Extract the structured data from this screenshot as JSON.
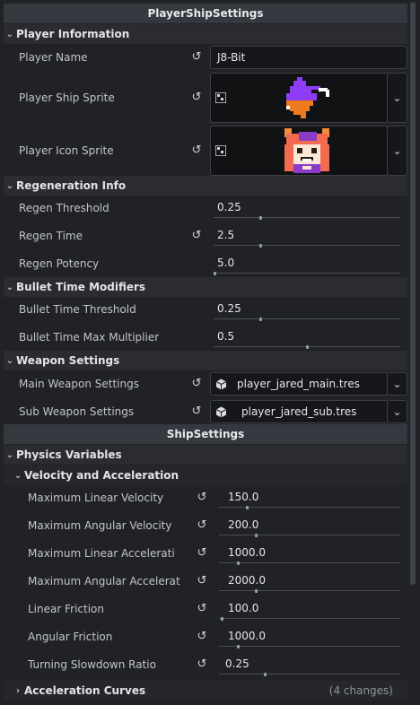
{
  "player_ship_settings": {
    "title": "PlayerShipSettings",
    "player_information": {
      "label": "Player Information",
      "player_name": {
        "label": "Player Name",
        "value": "J8-Bit"
      },
      "player_ship_sprite": {
        "label": "Player Ship Sprite"
      },
      "player_icon_sprite": {
        "label": "Player Icon Sprite"
      }
    },
    "regeneration_info": {
      "label": "Regeneration Info",
      "regen_threshold": {
        "label": "Regen Threshold",
        "value": "0.25",
        "slider": 0.25
      },
      "regen_time": {
        "label": "Regen Time",
        "value": "2.5",
        "slider": 0.25
      },
      "regen_potency": {
        "label": "Regen Potency",
        "value": "5.0",
        "slider": 0.0
      }
    },
    "bullet_time_modifiers": {
      "label": "Bullet Time Modifiers",
      "bullet_time_threshold": {
        "label": "Bullet Time Threshold",
        "value": "0.25",
        "slider": 0.25
      },
      "bullet_time_max_multiplier": {
        "label": "Bullet Time Max Multiplier",
        "value": "0.5",
        "slider": 0.5
      }
    },
    "weapon_settings": {
      "label": "Weapon Settings",
      "main_weapon_settings": {
        "label": "Main Weapon Settings",
        "value": "player_jared_main.tres"
      },
      "sub_weapon_settings": {
        "label": "Sub Weapon Settings",
        "value": "player_jared_sub.tres"
      }
    }
  },
  "ship_settings": {
    "title": "ShipSettings",
    "physics_variables": {
      "label": "Physics Variables",
      "velocity_and_acceleration": {
        "label": "Velocity and Acceleration",
        "maximum_linear_velocity": {
          "label": "Maximum Linear Velocity",
          "value": "150.0",
          "slider": 0.15
        },
        "maximum_angular_velocity": {
          "label": "Maximum Angular Velocity",
          "value": "200.0",
          "slider": 0.2
        },
        "maximum_linear_acceleration": {
          "label": "Maximum Linear Accelerati",
          "value": "1000.0",
          "slider": 0.1
        },
        "maximum_angular_acceleration": {
          "label": "Maximum Angular Accelerat",
          "value": "2000.0",
          "slider": 0.2
        },
        "linear_friction": {
          "label": "Linear Friction",
          "value": "100.0",
          "slider": 0.01
        },
        "angular_friction": {
          "label": "Angular Friction",
          "value": "1000.0",
          "slider": 0.1
        },
        "turning_slowdown_ratio": {
          "label": "Turning Slowdown Ratio",
          "value": "0.25",
          "slider": 0.25
        }
      },
      "acceleration_curves": {
        "label": "Acceleration Curves",
        "changes": "(4 changes)"
      }
    }
  },
  "icons": {
    "collapse": "chevron-down-icon",
    "expand": "chevron-right-icon",
    "revert": "revert-icon",
    "resource": "resource-cube-icon",
    "texture": "texture-icon",
    "dropdown": "chevron-down-icon"
  }
}
